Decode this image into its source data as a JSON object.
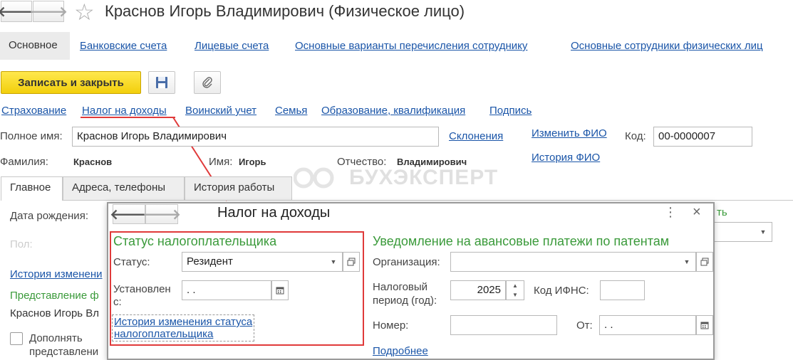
{
  "window": {
    "title": "Краснов Игорь Владимирович (Физическое лицо)",
    "back_glyph": "🡐",
    "forward_glyph": "🡒",
    "star_glyph": "☆"
  },
  "sections": {
    "active": "Основное",
    "links": [
      "Банковские счета",
      "Лицевые счета",
      "Основные варианты перечисления сотруднику",
      "Основные сотрудники физических лиц"
    ]
  },
  "toolbar": {
    "save_close_label": "Записать и закрыть"
  },
  "sublinks": [
    "Страхование",
    "Налог на доходы",
    "Воинский учет",
    "Семья",
    "Образование, квалификация",
    "Подпись"
  ],
  "person": {
    "full_name_label": "Полное имя:",
    "full_name_value": "Краснов Игорь Владимирович",
    "declensions_link": "Склонения",
    "change_fio_link": "Изменить ФИО",
    "history_fio_link": "История ФИО",
    "code_label": "Код:",
    "code_value": "00-0000007",
    "surname_label": "Фамилия:",
    "surname_value": "Краснов",
    "name_label": "Имя:",
    "name_value": "Игорь",
    "patronymic_label": "Отчество:",
    "patronymic_value": "Владимирович"
  },
  "tabs": [
    "Главное",
    "Адреса, телефоны",
    "История работы"
  ],
  "watermark": "БУХЭКСПЕРТ",
  "main_tab": {
    "birth_date_label": "Дата рождения:",
    "gender_label": "Пол:",
    "history_link": "История изменени",
    "representation_label": "Представление ф",
    "representation_value": "Краснов Игорь Вл",
    "supplement_label_line1": "Дополнять",
    "supplement_label_line2": "представлени",
    "right_link_fragment": "ть"
  },
  "modal": {
    "title": "Налог на доходы",
    "menu_glyph": "⋮",
    "close_glyph": "×",
    "taxpayer_status": {
      "header": "Статус налогоплательщика",
      "status_label": "Статус:",
      "status_value": "Резидент",
      "since_label_line1": "Установлен",
      "since_label_line2": "с:",
      "since_value": " .  .",
      "history_link_line1": "История изменения статуса",
      "history_link_line2": "налогоплательщика"
    },
    "patent": {
      "header": "Уведомление на авансовые платежи по патентам",
      "org_label": "Организация:",
      "org_value": "",
      "period_label_line1": "Налоговый",
      "period_label_line2": "период (год):",
      "period_value": "2025",
      "ifns_label": "Код ИФНС:",
      "ifns_value": "",
      "number_label": "Номер:",
      "number_value": "",
      "from_label": "От:",
      "from_value": " .  .",
      "more_link": "Подробнее"
    }
  },
  "colors": {
    "accent_link": "#1a55a8",
    "green_header": "#3a9a3a",
    "highlight_red": "#e03a3a",
    "save_button": "#f2cf0c"
  }
}
